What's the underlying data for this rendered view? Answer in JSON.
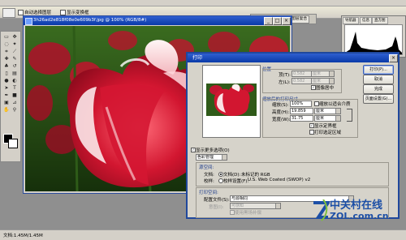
{
  "options_bar": {
    "auto_select_layer": "自动选择图层",
    "show_bounds": "显示变换框"
  },
  "palette_well": {
    "tabs": [
      "画笔",
      "工具预设",
      "图层复合"
    ]
  },
  "document": {
    "title": "3h26ad2e818f08e0e609b3f.jpg @ 100% (RGB/8#)"
  },
  "navigator": {
    "tabs": [
      "导航器",
      "信息",
      "直方图"
    ]
  },
  "dialog": {
    "title": "打印",
    "buttons": [
      "打印(P)...",
      "取消",
      "完成",
      "页面设置(G)..."
    ],
    "position": {
      "group_label": "位置",
      "top_label": "顶(T):",
      "top_value": "0.582",
      "top_unit": "厘米",
      "left_label": "左(L):",
      "left_value": "0.582",
      "left_unit": "厘米",
      "center_image": "图像居中"
    },
    "scaled": {
      "group_label": "缩放后的打印尺寸",
      "scale_label": "缩放(S):",
      "scale_value": "100%",
      "fit_media": "缩放以适合介质",
      "height_label": "高度(H):",
      "height_value": "19.859",
      "height_unit": "厘米",
      "width_label": "宽度(W):",
      "width_value": "31.75",
      "width_unit": "厘米",
      "show_bbox": "显示定界框",
      "print_selected": "打印选定区域"
    },
    "show_more_options": "显示更多选项(O)",
    "color_management_select": "色彩管理",
    "source_space": {
      "group_label": "源空间:",
      "document_label": "文档:",
      "document_option": "文档(D):",
      "document_value": "未标记的 RGB",
      "proof_label": "校样:",
      "proof_option": "校样设置(F):",
      "proof_value": "U.S. Web Coated (SWOP) v2"
    },
    "print_space": {
      "group_label": "打印空间:",
      "profile_label": "配置文件(S):",
      "profile_value": "与源相同",
      "intent_label": "意图(I):",
      "intent_value": "可感知",
      "black_point": "使用黑场补偿"
    }
  },
  "status_bar": {
    "text": "文档:1.45M/1.45M"
  },
  "watermark": {
    "cn": "中关村在线",
    "en": "ZOL.com.cn"
  },
  "colors": {
    "titlebar": "#0a3aa8",
    "dialog_bg": "#d6d3ca",
    "tulip_red": "#c8102e",
    "watermark_blue": "#1c4fa6"
  }
}
